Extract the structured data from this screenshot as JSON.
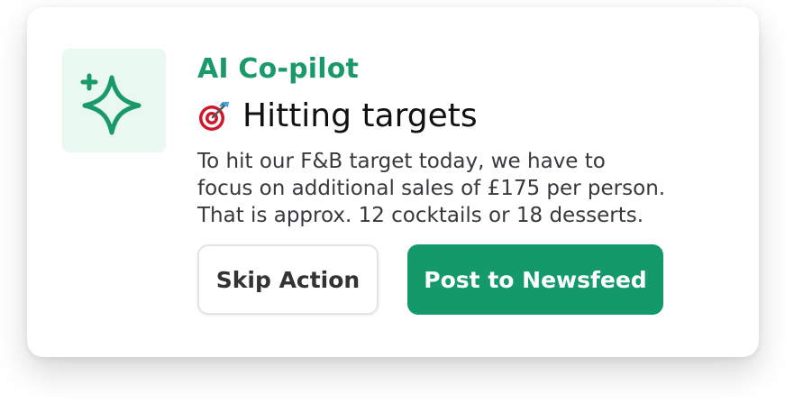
{
  "card": {
    "eyebrow": "AI Co-pilot",
    "title": "Hitting targets",
    "title_icon": "direct-hit-target-icon",
    "message": "To hit our F&B target today, we have to\nfocus on additional sales of £175 per person.\nThat is approx. 12 cocktails or 18 desserts.",
    "feature_icon": "sparkle-icon"
  },
  "actions": {
    "skip_label": "Skip Action",
    "post_label": "Post to Newsfeed"
  },
  "colors": {
    "accent": "#14996a",
    "accent_light": "#e9f8f0",
    "text": "#39393d",
    "title": "#111111"
  }
}
